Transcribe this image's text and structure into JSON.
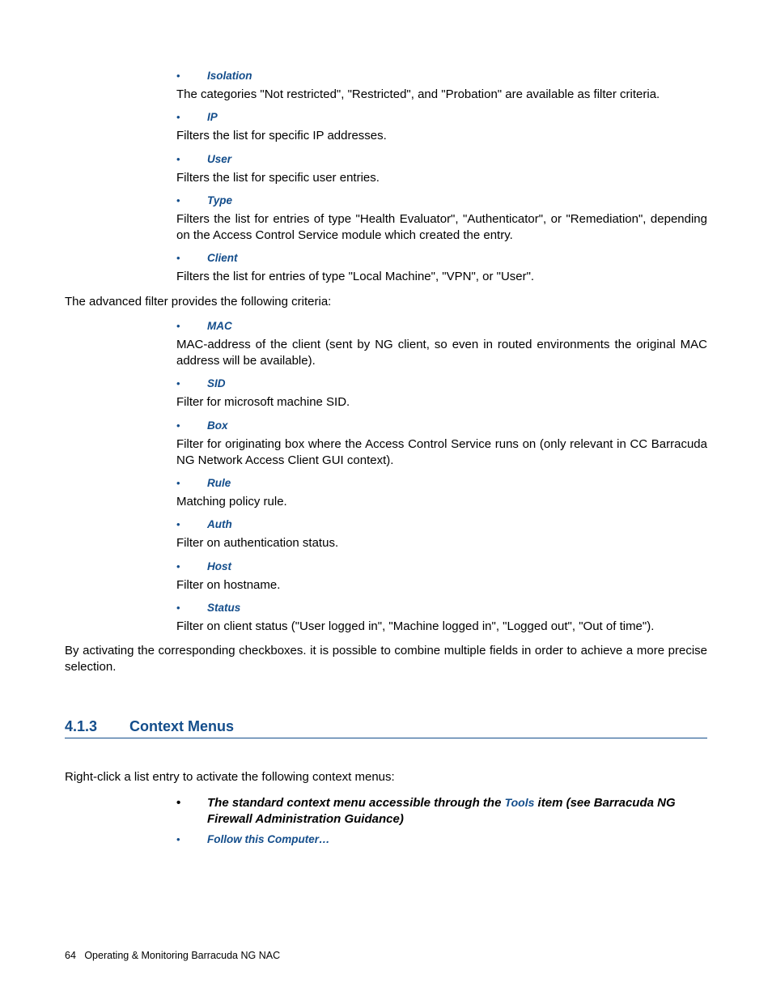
{
  "filters_basic": [
    {
      "name": "Isolation",
      "desc": "The categories \"Not restricted\", \"Restricted\", and \"Probation\" are available as filter criteria."
    },
    {
      "name": "IP",
      "desc": "Filters the list for specific IP addresses."
    },
    {
      "name": "User",
      "desc": "Filters the list for specific user entries."
    },
    {
      "name": "Type",
      "desc": "Filters the list for entries of type \"Health Evaluator\", \"Authenticator\", or \"Remediation\", depending on the Access Control Service module which created the entry."
    },
    {
      "name": "Client",
      "desc": "Filters the list for entries of type \"Local Machine\", \"VPN\", or \"User\"."
    }
  ],
  "advanced_intro": "The advanced filter provides the following criteria:",
  "filters_advanced": [
    {
      "name": "MAC",
      "desc": "MAC-address of the client (sent by NG client, so even in routed environments the original MAC address will be available)."
    },
    {
      "name": "SID",
      "desc": "Filter for microsoft machine SID."
    },
    {
      "name": "Box",
      "desc": "Filter for originating box where the Access Control Service runs on (only relevant in CC Barracuda NG Network Access Client GUI context)."
    },
    {
      "name": "Rule",
      "desc": "Matching policy rule."
    },
    {
      "name": "Auth",
      "desc": "Filter on authentication status."
    },
    {
      "name": "Host",
      "desc": "Filter on hostname."
    },
    {
      "name": "Status",
      "desc": "Filter on client status (\"User logged in\", \"Machine logged in\", \"Logged out\", \"Out of time\")."
    }
  ],
  "closing_para": "By activating the corresponding checkboxes. it is possible to combine multiple fields in order to achieve a more precise selection.",
  "section": {
    "number": "4.1.3",
    "title": "Context Menus",
    "intro": "Right-click a list entry to activate the following context menus:",
    "items": [
      {
        "pre": "The standard context menu accessible through the ",
        "tools": "Tools",
        "post": " item (see Barracuda NG Firewall Administration Guidance)"
      },
      {
        "text": "Follow this Computer…"
      }
    ]
  },
  "footer": {
    "page": "64",
    "title": "Operating & Monitoring Barracuda NG NAC"
  }
}
